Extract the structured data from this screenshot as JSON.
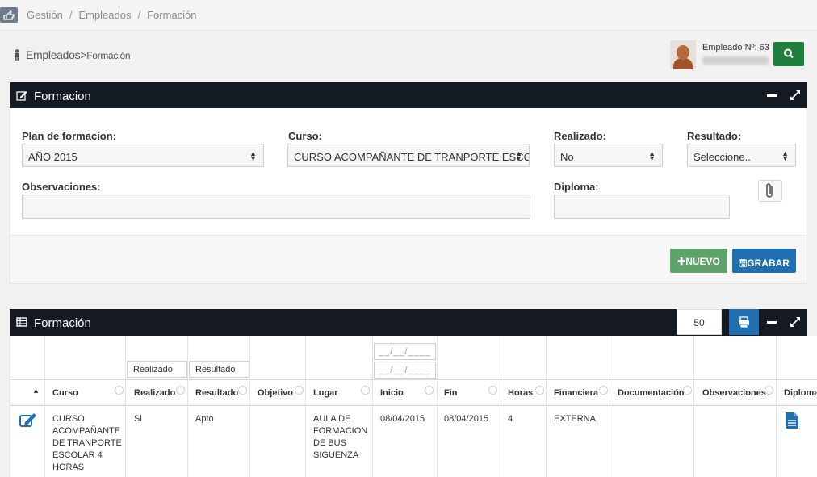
{
  "breadcrumb": {
    "items": [
      "Gestión",
      "Empleados",
      "Formación"
    ],
    "sep": "/"
  },
  "subheader": {
    "section": "Empleados",
    "arrow": ">",
    "page": "Formación"
  },
  "employee": {
    "label": "Empleado Nº: 63"
  },
  "form_panel": {
    "title": "Formacion",
    "plan": {
      "label": "Plan de formacion:",
      "value": "AÑO 2015"
    },
    "curso": {
      "label": "Curso:",
      "value": "CURSO ACOMPAÑANTE DE TRANPORTE ESCO"
    },
    "realizado": {
      "label": "Realizado:",
      "value": "No"
    },
    "resultado": {
      "label": "Resultado:",
      "value": "Seleccione.."
    },
    "observaciones": {
      "label": "Observaciones:",
      "value": ""
    },
    "diploma": {
      "label": "Diploma:",
      "value": ""
    },
    "nuevo_label": "NUEVO",
    "grabar_label": "GRABAR"
  },
  "table_panel": {
    "title": "Formación",
    "page_size": "50",
    "filters": {
      "realizado": "Realizado",
      "resultado": "Resultado",
      "inicio": "__/__/____",
      "fin": "__/__/____"
    },
    "columns": [
      "Curso",
      "Realizado",
      "Resultado",
      "Objetivo",
      "Lugar",
      "Inicio",
      "Fin",
      "Horas",
      "Financiera",
      "Documentación",
      "Observaciones",
      "Diploma"
    ],
    "rows": [
      {
        "curso": [
          "CURSO",
          "ACOMPAÑANTE",
          "DE TRANPORTE",
          "ESCOLAR 4",
          "HORAS"
        ],
        "realizado": "Si",
        "resultado": "Apto",
        "objetivo": "",
        "lugar": [
          "AULA DE",
          "FORMACION",
          "DE BUS",
          "SIGUENZA"
        ],
        "inicio": "08/04/2015",
        "fin": "08/04/2015",
        "horas": "4",
        "financiera": "EXTERNA",
        "documentacion": "",
        "observaciones": ""
      }
    ]
  },
  "colors": {
    "panel_header": "#141a22",
    "nuevo": "#5fa36b",
    "grabar": "#1f6fb1",
    "search": "#1f7f3c"
  }
}
